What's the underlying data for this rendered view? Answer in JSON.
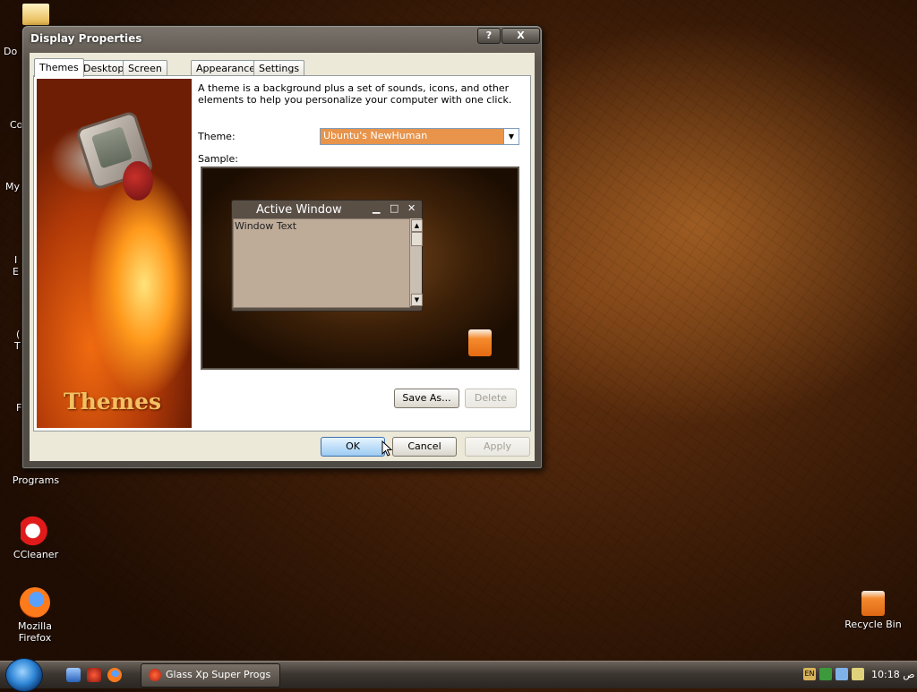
{
  "desktop": {
    "partial_labels": [
      "Do",
      "Co",
      "My",
      "I",
      "E",
      "(",
      "T",
      "F"
    ],
    "icons": [
      {
        "label": "Programs"
      },
      {
        "label": "CCleaner"
      },
      {
        "label": "Mozilla Firefox"
      },
      {
        "label": "Recycle Bin"
      }
    ]
  },
  "dialog": {
    "title": "Display Properties",
    "help_label": "?",
    "close_label": "X",
    "tabs": [
      "Themes",
      "Desktop",
      "Screen Saver",
      "Appearance",
      "Settings"
    ],
    "art_title": "Themes",
    "description": "A theme is a background plus a set of sounds, icons, and other elements to help you personalize your computer with one click.",
    "theme_label": "Theme:",
    "theme_value": "Ubuntu's NewHuman",
    "sample_label": "Sample:",
    "sample_window": {
      "title": "Active Window",
      "minimize": "▁",
      "maximize": "□",
      "close": "✕",
      "text": "Window Text"
    },
    "buttons": {
      "save_as": "Save As...",
      "delete": "Delete",
      "ok": "OK",
      "cancel": "Cancel",
      "apply": "Apply"
    }
  },
  "taskbar": {
    "task_label": "Glass Xp Super Progs",
    "tray_lang": "EN",
    "clock": "10:18 ص"
  },
  "colors": {
    "theme_combo_bg": "#e8944b",
    "accent": "#2f86d6"
  }
}
